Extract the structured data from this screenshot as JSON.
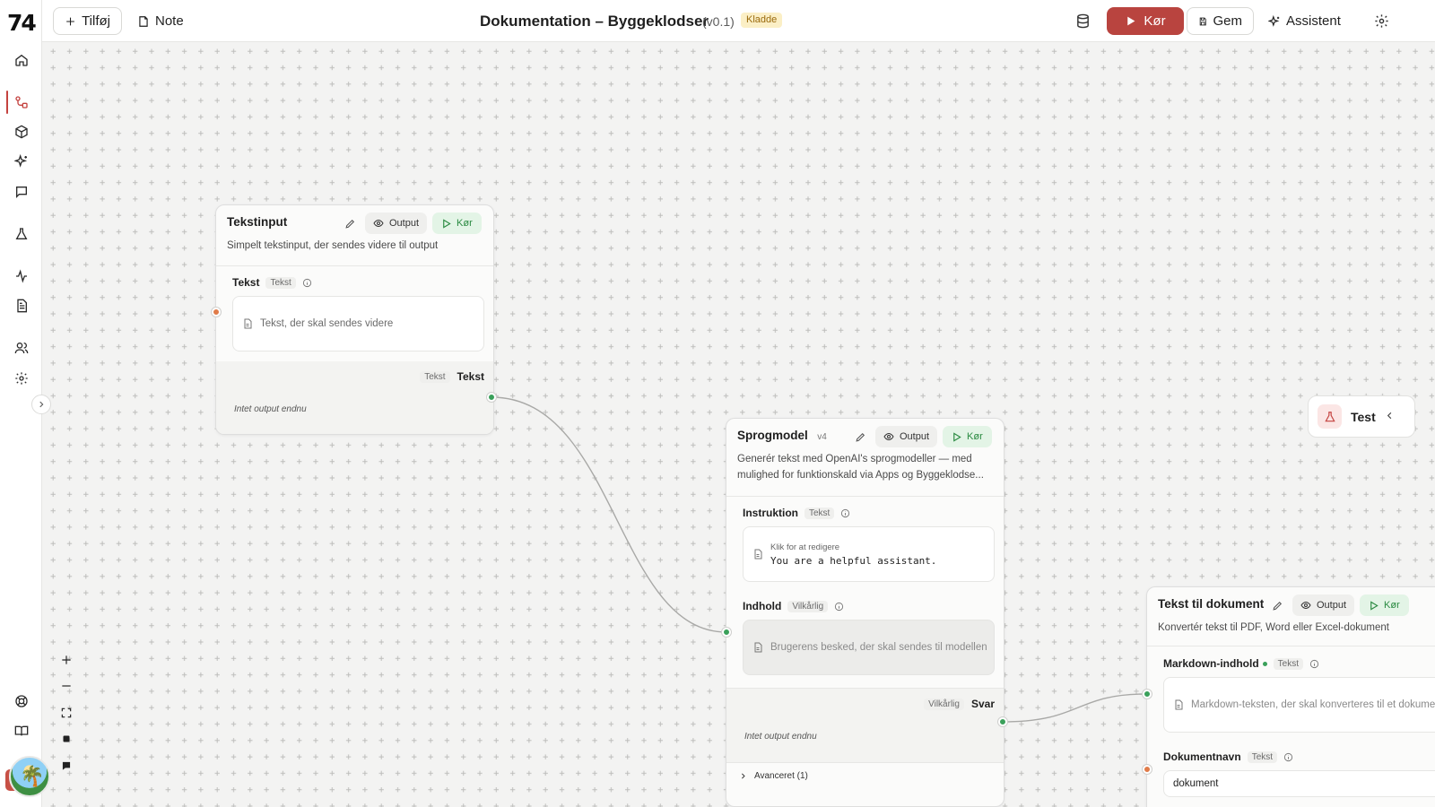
{
  "app": {
    "logo": "74",
    "title": "Dokumentation – Byggeklodser",
    "version": "(v0.1)",
    "status_badge": "Kladde"
  },
  "toolbar": {
    "add_label": "Tilføj",
    "note_label": "Note",
    "run_label": "Kør",
    "save_label": "Gem",
    "assistant_label": "Assistent"
  },
  "sidebar": {
    "items": [
      {
        "icon": "home-icon"
      },
      {
        "icon": "workflow-icon",
        "active": true
      },
      {
        "icon": "cube-icon"
      },
      {
        "icon": "sparkles-icon"
      },
      {
        "icon": "chat-icon"
      },
      {
        "icon": "flask-icon"
      },
      {
        "icon": "activity-icon"
      },
      {
        "icon": "document-icon"
      },
      {
        "icon": "users-icon"
      },
      {
        "icon": "gear-icon"
      }
    ],
    "bottom": [
      {
        "icon": "help-icon"
      },
      {
        "icon": "book-icon"
      }
    ]
  },
  "nodes": {
    "text_input": {
      "title": "Tekstinput",
      "description": "Simpelt tekstinput, der sendes videre til output",
      "output_label": "Output",
      "run_label": "Kør",
      "field_label": "Tekst",
      "field_tag": "Tekst",
      "field_placeholder": "Tekst, der skal sendes videre",
      "out_tag": "Tekst",
      "out_label": "Tekst",
      "no_output": "Intet output endnu"
    },
    "language_model": {
      "title": "Sprogmodel",
      "version": "v4",
      "description": "Generér tekst med OpenAI's sprogmodeller — med mulighed for funktionskald via Apps og Byggeklodse...",
      "output_label": "Output",
      "run_label": "Kør",
      "instruction_label": "Instruktion",
      "instruction_tag": "Tekst",
      "instruction_hint": "Klik for at redigere",
      "instruction_value": "You are a helpful assistant.",
      "content_label": "Indhold",
      "content_tag": "Vilkårlig",
      "content_placeholder": "Brugerens besked, der skal sendes til modellen",
      "out_tag": "Vilkårlig",
      "out_label": "Svar",
      "no_output": "Intet output endnu",
      "advanced_label": "Avanceret (1)"
    },
    "text_to_doc": {
      "title": "Tekst til dokument",
      "description": "Konvertér tekst til PDF, Word eller Excel-dokument",
      "output_label": "Output",
      "run_label": "Kør",
      "markdown_label": "Markdown-indhold",
      "markdown_tag": "Tekst",
      "markdown_placeholder": "Markdown-teksten, der skal konverteres til et dokument",
      "docname_label": "Dokumentnavn",
      "docname_tag": "Tekst",
      "docname_value": "dokument"
    }
  },
  "test_panel": {
    "label": "Test"
  },
  "colors": {
    "accent": "#b9443f",
    "run_green": "#2a8a41",
    "handle_green": "#3aa05a",
    "handle_orange": "#e07b49",
    "draft_bg": "#fbefc6"
  }
}
